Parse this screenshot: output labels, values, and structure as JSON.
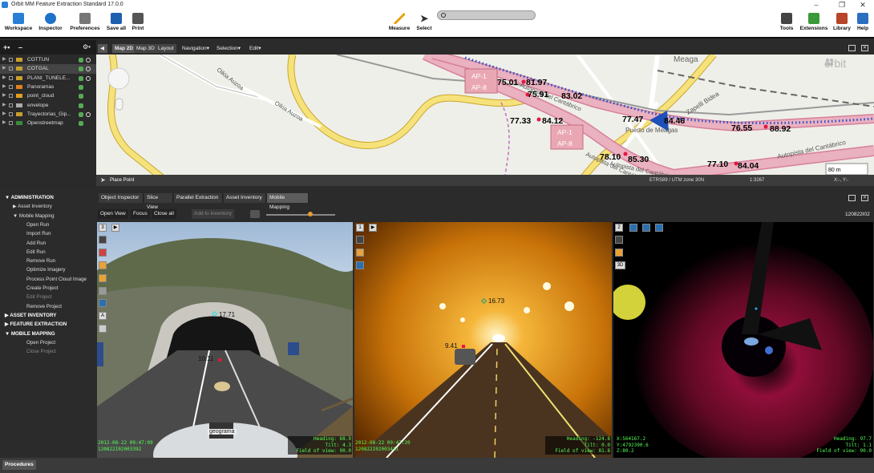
{
  "window": {
    "title": "Orbit MM Feature Extraction Standard 17.0.0"
  },
  "ribbon": {
    "left": [
      {
        "label": "Workspace",
        "icon": "workspace-icon"
      },
      {
        "label": "Inspector",
        "icon": "inspector-icon"
      },
      {
        "label": "Preferences",
        "icon": "preferences-icon"
      },
      {
        "label": "Save all",
        "icon": "save-icon"
      },
      {
        "label": "Print",
        "icon": "print-icon"
      }
    ],
    "center": [
      {
        "label": "Measure",
        "icon": "measure-icon"
      },
      {
        "label": "Select",
        "icon": "select-icon"
      }
    ],
    "right": [
      {
        "label": "Tools",
        "icon": "tools-icon"
      },
      {
        "label": "Extensions",
        "icon": "extensions-icon"
      },
      {
        "label": "Library",
        "icon": "library-icon"
      },
      {
        "label": "Help",
        "icon": "help-icon"
      }
    ]
  },
  "layers": [
    {
      "name": "COTTUN",
      "selected": false,
      "icons": 2
    },
    {
      "name": "COTGAL",
      "selected": true,
      "icons": 2
    },
    {
      "name": "PLANI_TUNELE...",
      "selected": false,
      "icons": 2
    },
    {
      "name": "Panoramas",
      "selected": false,
      "icons": 1
    },
    {
      "name": "point_cloud",
      "selected": false,
      "icons": 1
    },
    {
      "name": "envelope",
      "selected": false,
      "icons": 1
    },
    {
      "name": "Trayectorias_Gip...",
      "selected": false,
      "icons": 2
    },
    {
      "name": "Openstreetmap",
      "selected": false,
      "icons": 1
    }
  ],
  "map_tabs": {
    "map2d": "Map 2D",
    "map3d": "Map 3D",
    "layout": "Layout",
    "navigation": "Navigation",
    "selection": "Selection",
    "edit": "Edit"
  },
  "map": {
    "brand": "orbit",
    "places": [
      "Meaga",
      "Oikia Auzoa",
      "Oikia Auzoa",
      "Puerto de Meagas",
      "Zapelli Bidea",
      "Autopista del Cantábrico",
      "Autopista del Cantábrico",
      "Autopista del Cantábrico",
      "Autopista del Cantábrico"
    ],
    "shields": [
      [
        "AP-1",
        "AP-8"
      ],
      [
        "AP-1",
        "AP-8"
      ]
    ],
    "values": [
      "75.01",
      "81.97",
      "75.91",
      "83.02",
      "77.33",
      "84.12",
      "77.47",
      "84.46",
      "76.55",
      "88.92",
      "78.10",
      "85.30",
      "77.10",
      "84.04"
    ],
    "scale": "80 m",
    "status": {
      "tool": "Place Point",
      "crs": "ETRS89 / UTM zone 30N",
      "scale": "1:3267",
      "coords": "X:-, Y:-"
    }
  },
  "admin_tree": [
    {
      "label": "ADMINISTRATION",
      "level": 0,
      "header": true,
      "open": true
    },
    {
      "label": "Asset Inventory",
      "level": 1,
      "open": false
    },
    {
      "label": "Mobile Mapping",
      "level": 1,
      "open": true
    },
    {
      "label": "Open Run",
      "level": 2
    },
    {
      "label": "Import Run",
      "level": 2
    },
    {
      "label": "Add Run",
      "level": 2
    },
    {
      "label": "Edit Run",
      "level": 2
    },
    {
      "label": "Remove Run",
      "level": 2
    },
    {
      "label": "Optimize Imagery",
      "level": 2
    },
    {
      "label": "Process Point Cloud Image",
      "level": 2
    },
    {
      "label": "Create Project",
      "level": 2
    },
    {
      "label": "Edit Project",
      "level": 2,
      "disabled": true
    },
    {
      "label": "Remove Project",
      "level": 2
    },
    {
      "label": "ASSET INVENTORY",
      "level": 0,
      "header": true,
      "open": false
    },
    {
      "label": "FEATURE EXTRACTION",
      "level": 0,
      "header": true,
      "open": false
    },
    {
      "label": "MOBILE MAPPING",
      "level": 0,
      "header": true,
      "open": true
    },
    {
      "label": "Open Project",
      "level": 2
    },
    {
      "label": "Close Project",
      "level": 2,
      "disabled": true
    }
  ],
  "view_tabs": [
    "Object Inspector",
    "Slice View",
    "Parallel Extraction",
    "Asset Inventory",
    "Mobile Mapping"
  ],
  "view_buttons": {
    "open_view": "Open View",
    "focus": "Focus",
    "close_all": "Close all",
    "add_inventory": "Add to inventory",
    "run_id": "120822I02"
  },
  "panes": [
    {
      "num": "3",
      "measure_a": "17.71",
      "measure_b": "10.11",
      "timestamp": "2012-08-22 09:47:09",
      "record": "120822I02003392",
      "heading_label": "Heading:",
      "heading": "68.9",
      "tilt_label": "Tilt:",
      "tilt": "4.3",
      "fov_label": "Field of view:",
      "fov": "90.0",
      "sign": "geograma"
    },
    {
      "num": "1",
      "measure_a": "16.73",
      "measure_b": "9.41",
      "timestamp": "2012-08-22 09:47:20",
      "record": "120822I02003411",
      "heading_label": "Heading:",
      "heading": "-124.8",
      "tilt_label": "Tilt:",
      "tilt": "0.0",
      "fov_label": "Field of view:",
      "fov": "81.8"
    },
    {
      "num": "2",
      "btn3d": "3D",
      "x": "X:564167.2",
      "y": "Y:4792390.6",
      "z": "Z:80.2",
      "heading_label": "Heading:",
      "heading": "97.7",
      "tilt_label": "Tilt:",
      "tilt": "1.1",
      "fov_label": "Field of view:",
      "fov": "90.0"
    }
  ],
  "bottom": {
    "procedures": "Procedures"
  },
  "colors": {
    "accent": "#2a7fd4",
    "route": "#e7a2b3",
    "hud": "#55ff55",
    "point": "#e8143c"
  }
}
